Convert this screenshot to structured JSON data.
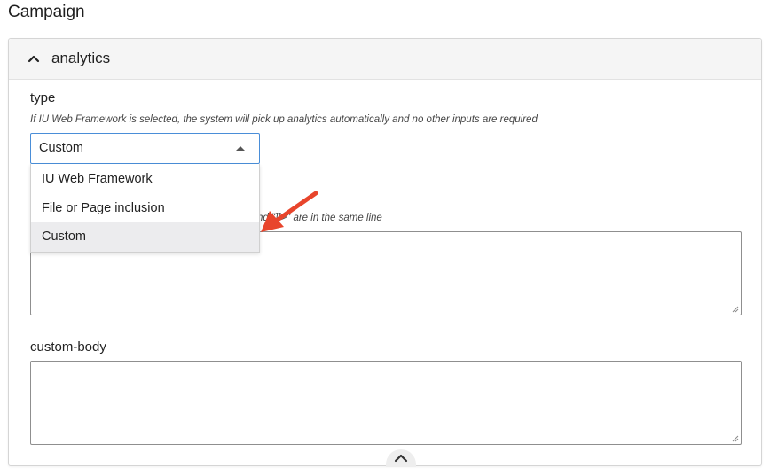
{
  "page": {
    "title": "Campaign"
  },
  "panel": {
    "title": "analytics",
    "collapse_icon": "chevron-up-icon"
  },
  "type_field": {
    "label": "type",
    "help": "If IU Web Framework is selected, the system will pick up analytics automatically and no other inputs are required",
    "selected_value": "Custom",
    "options": [
      {
        "label": "IU Web Framework",
        "selected": false
      },
      {
        "label": "File or Page inclusion",
        "selected": false
      },
      {
        "label": "Custom",
        "selected": true
      }
    ]
  },
  "custom_head_field": {
    "help_visible_fragment": "nd \"]]>\" are in the same line"
  },
  "custom_body_field": {
    "label": "custom-body"
  },
  "footer": {
    "scroll_icon": "chevron-up-icon"
  },
  "annotation": {
    "arrow_color": "#e8452c"
  },
  "colors": {
    "focus_border": "#4a8ed8",
    "option_highlight": "#ececee"
  }
}
